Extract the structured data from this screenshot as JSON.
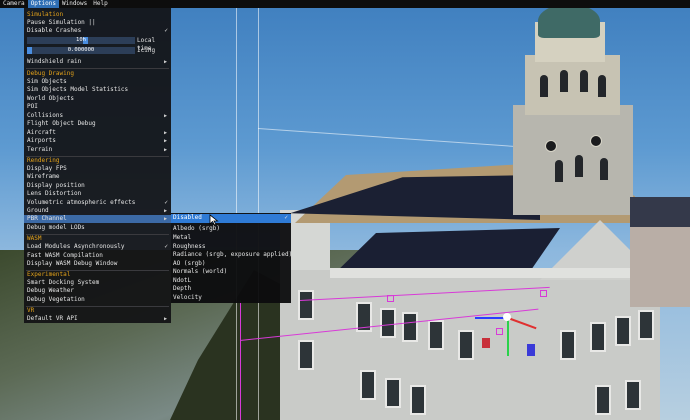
{
  "menubar": {
    "items": [
      "Camera",
      "Options",
      "Windows",
      "Help"
    ],
    "active": "Options"
  },
  "menu": {
    "simulation": {
      "header": "Simulation",
      "pause": "Pause Simulation ||",
      "disable_crashes": "Disable Crashes",
      "time_value": "10h",
      "time_label": "Local time",
      "icing_value": "0.000000",
      "icing_label": "Icing",
      "windshield": "Windshield rain"
    },
    "debug_drawing": {
      "header": "Debug Drawing",
      "sim_objects": "Sim Objects",
      "sim_objects_model_stats": "Sim Objects Model Statistics",
      "world_objects": "World Objects",
      "poi": "POI",
      "collisions": "Collisions",
      "flight_object_debug": "Flight Object Debug",
      "aircraft": "Aircraft",
      "airports": "Airports",
      "terrain": "Terrain"
    },
    "rendering": {
      "header": "Rendering",
      "display_fps": "Display FPS",
      "wireframe": "Wireframe",
      "display_position": "Display position",
      "lens_distortion": "Lens Distortion",
      "volumetric": "Volumetric atmospheric effects",
      "ground": "Ground",
      "pbr_channel": "PBR Channel",
      "debug_model_lods": "Debug model LODs"
    },
    "wasm": {
      "header": "WASM",
      "load_async": "Load Modules Asynchronously",
      "fast_compile": "Fast WASM Compilation",
      "debug_window": "Display WASM Debug Window"
    },
    "experimental": {
      "header": "Experimental",
      "smart_docking": "Smart Docking System",
      "debug_weather": "Debug Weather",
      "debug_vegetation": "Debug Vegetation"
    },
    "vr": {
      "header": "VR",
      "default_api": "Default VR API"
    }
  },
  "pbr_submenu": {
    "items": [
      "Disabled",
      "Albedo (srgb)",
      "Metal",
      "Roughness",
      "Radiance (srgb, exposure applied)",
      "AO (srgb)",
      "Normals (world)",
      "NdotL",
      "Depth",
      "Velocity"
    ],
    "selected": "Disabled"
  },
  "glyphs": {
    "check": "✓",
    "arrow": "▶"
  },
  "colors": {
    "accent": "#2f7bd6",
    "header": "#e3a21a",
    "menu_bg": "#121214"
  }
}
